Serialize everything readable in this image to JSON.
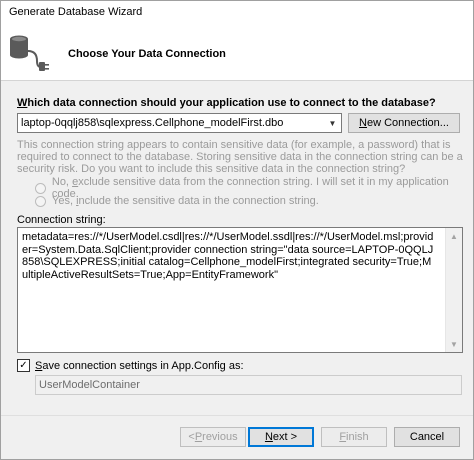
{
  "window": {
    "title": "Generate Database Wizard"
  },
  "header": {
    "heading": "Choose Your Data Connection",
    "icon": "database-plug-icon"
  },
  "question": {
    "before": "",
    "mnemonic": "W",
    "after": "hich data connection should your application use to connect to the database?"
  },
  "connection": {
    "selected": "laptop-0qqlj858\\sqlexpress.Cellphone_modelFirst.dbo"
  },
  "new_connection_button": {
    "before": "",
    "mnemonic": "N",
    "after": "ew Connection..."
  },
  "sensitive_info": "This connection string appears to contain sensitive data (for example, a password) that is required to connect to the database. Storing sensitive data in the connection string can be a security risk. Do you want to include this sensitive data in the connection string?",
  "radio_no": {
    "before": "No, ",
    "mnemonic": "e",
    "after": "xclude sensitive data from the connection string. I will set it in my application code."
  },
  "radio_yes": {
    "before": "Yes, ",
    "mnemonic": "i",
    "after": "nclude the sensitive data in the connection string."
  },
  "connection_string_label": "Connection string:",
  "connection_string": "metadata=res://*/UserModel.csdl|res://*/UserModel.ssdl|res://*/UserModel.msl;provider=System.Data.SqlClient;provider connection string=\"data source=LAPTOP-0QQLJ858\\SQLEXPRESS;initial catalog=Cellphone_modelFirst;integrated security=True;MultipleActiveResultSets=True;App=EntityFramework\"",
  "save_settings": {
    "checked": true,
    "before": "",
    "mnemonic": "S",
    "after": "ave connection settings in App.Config as:"
  },
  "container_name": "UserModelContainer",
  "buttons": {
    "previous": {
      "before": "< ",
      "mnemonic": "P",
      "after": "revious"
    },
    "next": {
      "before": "",
      "mnemonic": "N",
      "after": "ext >"
    },
    "finish": {
      "before": "",
      "mnemonic": "F",
      "after": "inish"
    },
    "cancel": "Cancel"
  }
}
